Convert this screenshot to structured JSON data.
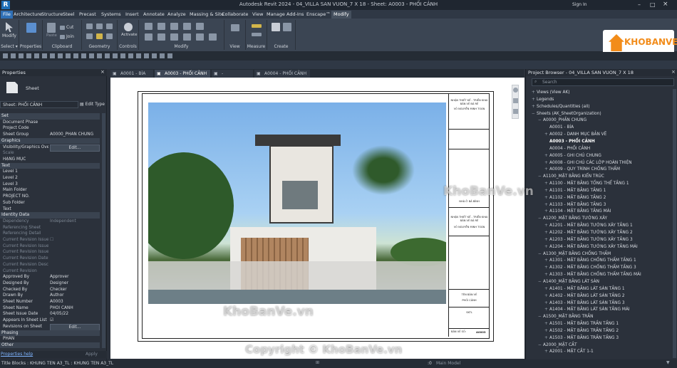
{
  "window": {
    "app_icon": "R",
    "title": "Autodesk Revit 2024 - 04_VILLA SAN VUON_7 X 18 - Sheet: A0003 - PHỐI CẢNH",
    "signin": "Sign In"
  },
  "menu": [
    "File",
    "Architecture",
    "Structure",
    "Steel",
    "Precast",
    "Systems",
    "Insert",
    "Annotate",
    "Analyze",
    "Massing & Site",
    "Collaborate",
    "View",
    "Manage",
    "Add-Ins",
    "Enscape™",
    "Modify"
  ],
  "ribbon": {
    "groups": [
      "Select ▾",
      "Properties",
      "Clipboard",
      "Geometry",
      "Controls",
      "Modify",
      "View",
      "Measure",
      "Create"
    ],
    "modify_label": "Modify",
    "cut": "Cut",
    "join": "Join",
    "paste": "Paste",
    "activate": "Activate"
  },
  "properties": {
    "title": "Properties",
    "type_name": "Sheet",
    "selector": "Sheet: PHỐI CẢNH",
    "edit_type": "Edit Type",
    "rows": [
      {
        "kind": "sect",
        "k": "Set"
      },
      {
        "k": "Document Phase",
        "v": ""
      },
      {
        "k": "Project Code",
        "v": ""
      },
      {
        "k": "Sheet Group",
        "v": "A0000_PHẦN CHUNG"
      },
      {
        "kind": "sect",
        "k": "Graphics"
      },
      {
        "k": "Visibility/Graphics Ove...",
        "v": "Edit...",
        "btn": true
      },
      {
        "k": "Scale",
        "v": "",
        "dim": true
      },
      {
        "k": "HẠNG MỤC",
        "v": ""
      },
      {
        "kind": "sect",
        "k": "Text"
      },
      {
        "k": "Level 1",
        "v": ""
      },
      {
        "k": "Level 2",
        "v": ""
      },
      {
        "k": "Level 3",
        "v": ""
      },
      {
        "k": "Main Folder",
        "v": ""
      },
      {
        "k": "PROJECT NO.",
        "v": ""
      },
      {
        "k": "Sub Folder",
        "v": ""
      },
      {
        "k": "Text",
        "v": ""
      },
      {
        "kind": "sect",
        "k": "Identity Data"
      },
      {
        "k": "Dependency",
        "v": "Independent",
        "dim": true
      },
      {
        "k": "Referencing Sheet",
        "v": "",
        "dim": true
      },
      {
        "k": "Referencing Detail",
        "v": "",
        "dim": true
      },
      {
        "k": "Current Revision Issued",
        "v": "☐",
        "dim": true
      },
      {
        "k": "Current Revision Issued...",
        "v": "",
        "dim": true
      },
      {
        "k": "Current Revision Issue...",
        "v": "",
        "dim": true
      },
      {
        "k": "Current Revision Date",
        "v": "",
        "dim": true
      },
      {
        "k": "Current Revision Descr...",
        "v": "",
        "dim": true
      },
      {
        "k": "Current Revision",
        "v": "",
        "dim": true
      },
      {
        "k": "Approved By",
        "v": "Approver"
      },
      {
        "k": "Designed By",
        "v": "Designer"
      },
      {
        "k": "Checked By",
        "v": "Checker"
      },
      {
        "k": "Drawn By",
        "v": "Author"
      },
      {
        "k": "Sheet Number",
        "v": "A0003"
      },
      {
        "k": "Sheet Name",
        "v": "PHỐI CẢNH"
      },
      {
        "k": "Sheet Issue Date",
        "v": "04/05/22"
      },
      {
        "k": "Appears In Sheet List",
        "v": "☑"
      },
      {
        "k": "Revisions on Sheet",
        "v": "Edit...",
        "btn": true
      },
      {
        "kind": "sect",
        "k": "Phasing"
      },
      {
        "k": "PHẦN",
        "v": ""
      },
      {
        "kind": "sect",
        "k": "Other"
      }
    ],
    "help": "Properties help",
    "apply": "Apply"
  },
  "tabs": [
    {
      "label": "A0001 - BÌA",
      "active": false
    },
    {
      "label": "A0003 - PHỐI CẢNH",
      "active": true
    },
    {
      "label": "-",
      "active": false
    },
    {
      "label": "A0004 - PHỐI CẢNH",
      "active": false
    }
  ],
  "titleblock": {
    "top1": "NHẬN THIẾT KẾ - TRIỂN KHAI BẢN VẼ BẢ RẺ",
    "top2": "VÕ NGUYỄN MINH TOÀN",
    "mid0": "NHÀ Ở BẢ BỈNH",
    "mid1": "NHẬN THIẾT KẾ - TRIỂN KHAI BẢN VẼ BẢ RẺ",
    "mid2": "VÕ NGUYỄN MINH TOÀN",
    "name_lbl": "TÊN BẢN VẼ",
    "name_val": "PHỐI CẢNH",
    "scale": "SKTL",
    "num_lbl": "BẢN VẼ SỐ:",
    "num_val": "A0003"
  },
  "project_browser": {
    "title": "Project Browser - 04_VILLA SAN VUON_7 X 18",
    "search": "Search",
    "nodes": [
      {
        "t": "Views (View AK)",
        "l": 0,
        "e": "+"
      },
      {
        "t": "Legends",
        "l": 0,
        "e": "+"
      },
      {
        "t": "Schedules/Quantities (all)",
        "l": 0,
        "e": "+"
      },
      {
        "t": "Sheets (AK_SheetOrganization)",
        "l": 0,
        "e": "−"
      },
      {
        "t": "A0000_PHẦN CHUNG",
        "l": 1,
        "e": "−"
      },
      {
        "t": "A0001 - BÌA",
        "l": 2,
        "e": ""
      },
      {
        "t": "A0002 - DANH MỤC BẢN VẼ",
        "l": 2,
        "e": "+"
      },
      {
        "t": "A0003 - PHỐI CẢNH",
        "l": 2,
        "e": "",
        "sel": true
      },
      {
        "t": "A0004 - PHỐI CẢNH",
        "l": 2,
        "e": ""
      },
      {
        "t": "A0005 - GHI CHÚ CHUNG",
        "l": 2,
        "e": "+"
      },
      {
        "t": "A0008 - GHI CHÚ CÁC LỚP HOÀN THIỆN",
        "l": 2,
        "e": "+"
      },
      {
        "t": "A0009 - QUY TRÌNH CHỐNG THẤM",
        "l": 2,
        "e": "+"
      },
      {
        "t": "A1100_MẶT BẰNG KIẾN TRÚC",
        "l": 1,
        "e": "−"
      },
      {
        "t": "A1100 - MẶT BẰNG TỔNG THỂ TẦNG 1",
        "l": 2,
        "e": "+"
      },
      {
        "t": "A1101 - MẶT BẰNG TẦNG 1",
        "l": 2,
        "e": "+"
      },
      {
        "t": "A1102 - MẶT BẰNG TẦNG 2",
        "l": 2,
        "e": "+"
      },
      {
        "t": "A1103 - MẶT BẰNG TẦNG 3",
        "l": 2,
        "e": "+"
      },
      {
        "t": "A1104 - MẶT BẰNG TẦNG MÁI",
        "l": 2,
        "e": "+"
      },
      {
        "t": "A1200_MẶT BẰNG TƯỜNG XÂY",
        "l": 1,
        "e": "−"
      },
      {
        "t": "A1201 - MẶT BẰNG TƯỜNG XÂY TẦNG 1",
        "l": 2,
        "e": "+"
      },
      {
        "t": "A1202 - MẶT BẰNG TƯỜNG XÂY TẦNG 2",
        "l": 2,
        "e": "+"
      },
      {
        "t": "A1203 - MẶT BẰNG TƯỜNG XÂY TẦNG 3",
        "l": 2,
        "e": "+"
      },
      {
        "t": "A1204 - MẶT BẰNG TƯỜNG XÂY TẦNG MÁI",
        "l": 2,
        "e": "+"
      },
      {
        "t": "A1300_MẶT BẰNG CHỐNG THẤM",
        "l": 1,
        "e": "−"
      },
      {
        "t": "A1301 - MẶT BẰNG CHỐNG THẤM TẦNG 1",
        "l": 2,
        "e": "+"
      },
      {
        "t": "A1302 - MẶT BẰNG CHỐNG THẤM TẦNG 3",
        "l": 2,
        "e": "+"
      },
      {
        "t": "A1303 - MẶT BẰNG CHỐNG THẤM TẦNG MÁI",
        "l": 2,
        "e": "+"
      },
      {
        "t": "A1400_MẶT BẰNG LÁT SÀN",
        "l": 1,
        "e": "−"
      },
      {
        "t": "A1401 - MẶT BẰNG LÁT SÀN TẦNG 1",
        "l": 2,
        "e": "+"
      },
      {
        "t": "A1402 - MẶT BẰNG LÁT SÀN TẦNG 2",
        "l": 2,
        "e": "+"
      },
      {
        "t": "A1403 - MẶT BẰNG LÁT SÀN TẦNG 3",
        "l": 2,
        "e": "+"
      },
      {
        "t": "A1404 - MẶT BẰNG LÁT SÀN TẦNG MÁI",
        "l": 2,
        "e": "+"
      },
      {
        "t": "A1500_MẶT BẰNG TRẦN",
        "l": 1,
        "e": "−"
      },
      {
        "t": "A1501 - MẶT BẰNG TRẦN TẦNG 1",
        "l": 2,
        "e": "+"
      },
      {
        "t": "A1502 - MẶT BẰNG TRẦN TẦNG 2",
        "l": 2,
        "e": "+"
      },
      {
        "t": "A1503 - MẶT BẰNG TRẦN TẦNG 3",
        "l": 2,
        "e": "+"
      },
      {
        "t": "A2000_MẶT CẮT",
        "l": 1,
        "e": "−"
      },
      {
        "t": "A2001 - MẶT CẮT 1-1",
        "l": 2,
        "e": "+"
      }
    ]
  },
  "status": {
    "left": "Title Blocks : KHUNG TEN A3_TL : KHUNG TEN A3_TL",
    "model": "Main Model",
    "zero": ":0"
  },
  "watermarks": {
    "brand": "KhoBanVe.vn",
    "copyright": "Copyright © KhoBanVe.vn",
    "logo": "KHOBANVE"
  }
}
